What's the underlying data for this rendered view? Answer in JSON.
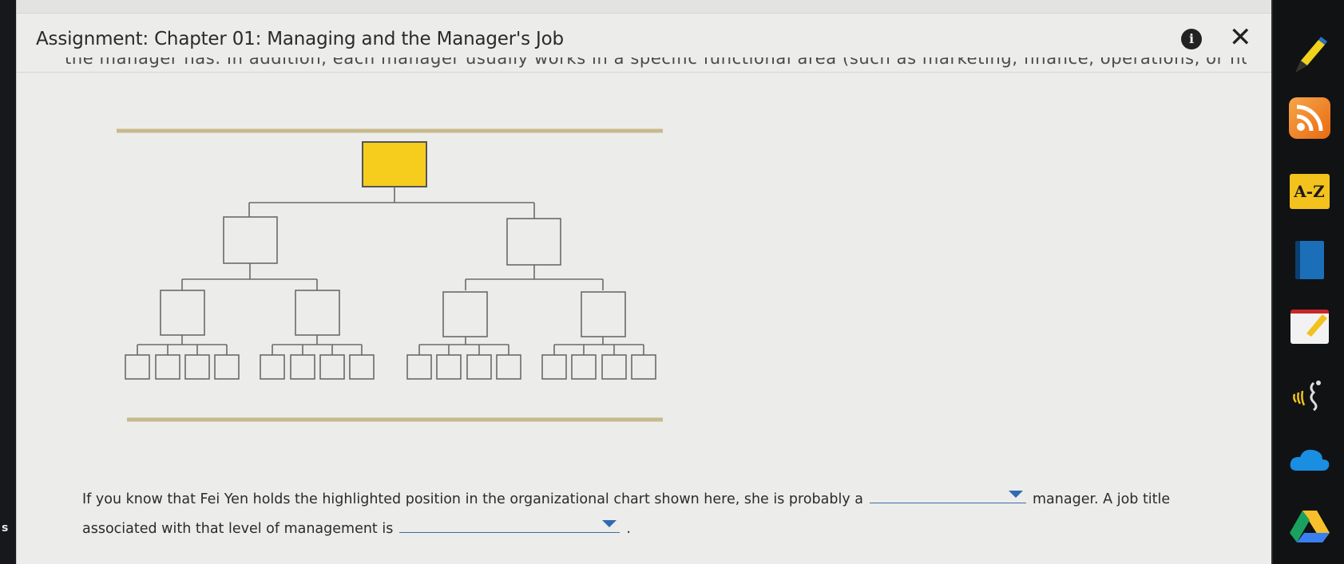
{
  "assignment": {
    "title": "Assignment: Chapter 01: Managing and the Manager's Job",
    "cut_off_text": "the manager has. In addition, each manager usually works in a specific functional area (such as marketing, finance, operations, or human resources)."
  },
  "icons": {
    "info": "info-icon",
    "close": "close-icon",
    "info_glyph": "i",
    "close_glyph": "✕"
  },
  "colors": {
    "highlight_box": "#f6cd1c",
    "rule": "#c8b98c",
    "dropdown_line": "#3e6ea6",
    "dropdown_arrow": "#2f6ab5"
  },
  "org_chart": {
    "levels": [
      "top",
      "middle",
      "first-line",
      "non-managerial"
    ],
    "highlighted_level": "top"
  },
  "question": {
    "text_1": "If you know that Fei Yen holds the highlighted position in the organizational chart shown here, she is probably a",
    "text_2": "manager. A job title associated with that level of management is",
    "text_3": ".",
    "dropdown_1_value": "",
    "dropdown_2_value": ""
  },
  "sidebar": {
    "items": [
      {
        "name": "pen-tool-icon"
      },
      {
        "name": "rss-feed-icon"
      },
      {
        "name": "a-z-glossary-icon",
        "label": "A-Z"
      },
      {
        "name": "ebook-icon"
      },
      {
        "name": "notes-icon"
      },
      {
        "name": "read-aloud-icon"
      },
      {
        "name": "cloud-storage-icon"
      },
      {
        "name": "google-drive-icon"
      }
    ]
  },
  "left_edge": {
    "label": "s"
  }
}
